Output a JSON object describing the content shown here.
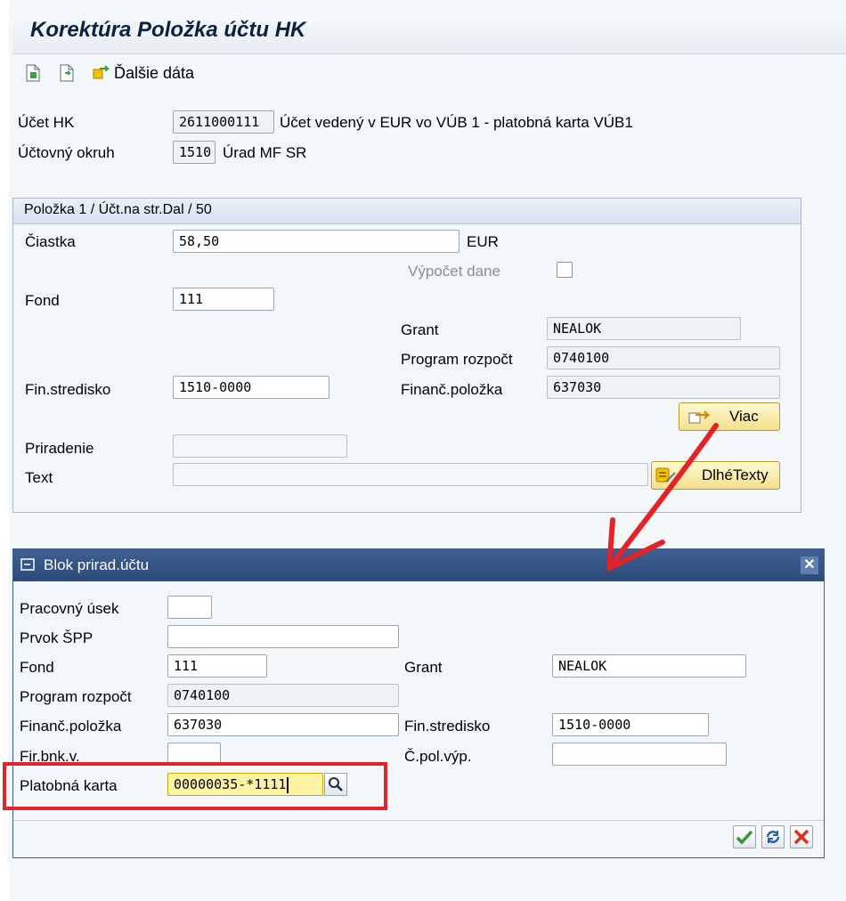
{
  "title": "Korektúra Položka účtu HK",
  "toolbar": {
    "more_data_label": "Ďalšie dáta"
  },
  "header": {
    "account_label": "Účet HK",
    "account_value": "2611000111",
    "account_desc": "Účet vedený v EUR vo VÚB 1 - platobná karta VÚB1",
    "company_label": "Účtovný okruh",
    "company_value": "1510",
    "company_desc": "Úrad MF SR"
  },
  "item": {
    "group_title": "Položka 1 / Účt.na str.Dal / 50",
    "amount_label": "Čiastka",
    "amount_value": "58,50",
    "currency": "EUR",
    "tax_calc_label": "Výpočet dane",
    "fund_label": "Fond",
    "fund_value": "111",
    "grant_label": "Grant",
    "grant_value": "NEALOK",
    "budget_program_label": "Program rozpočt",
    "budget_program_value": "0740100",
    "cost_center_label": "Fin.stredisko",
    "cost_center_value": "1510-0000",
    "commitment_item_label": "Finanč.položka",
    "commitment_item_value": "637030",
    "more_button": "Viac",
    "assignment_label": "Priradenie",
    "assignment_value": "",
    "text_label": "Text",
    "text_value": "",
    "long_texts_button": "DlhéTexty"
  },
  "dialog": {
    "title": "Blok prirad.účtu",
    "close": "✕",
    "work_unit_label": "Pracovný úsek",
    "work_unit_value": "",
    "wbs_label": "Prvok ŠPP",
    "wbs_value": "",
    "fund_label": "Fond",
    "fund_value": "111",
    "grant_label": "Grant",
    "grant_value": "NEALOK",
    "budget_program_label": "Program rozpočt",
    "budget_program_value": "0740100",
    "commitment_item_label": "Finanč.položka",
    "commitment_item_value": "637030",
    "cost_center_label": "Fin.stredisko",
    "cost_center_value": "1510-0000",
    "bank_label": "Fir.bnk.v.",
    "bank_value": "",
    "statement_item_label": "Č.pol.výp.",
    "statement_item_value": "",
    "card_label": "Platobná karta",
    "card_value": "00000035-*1111"
  },
  "colors": {
    "highlight": "#e2232a",
    "arrow": "#e2232a",
    "dialog_header": "#2d4a78"
  }
}
